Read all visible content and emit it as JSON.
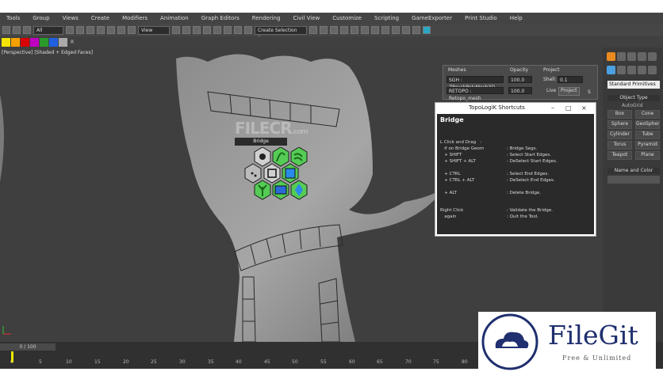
{
  "menu": [
    "Tools",
    "Group",
    "Views",
    "Create",
    "Modifiers",
    "Animation",
    "Graph Editors",
    "Rendering",
    "Civil View",
    "Customize",
    "Scripting",
    "GameExporter",
    "Print Studio",
    "Help"
  ],
  "toolbar": {
    "filter_value": "All",
    "view_value": "View",
    "selection_set_value": "Create Selection Se"
  },
  "colorbar": {
    "swatches": [
      "#f5e400",
      "#f5a000",
      "#d80000",
      "#c000c0",
      "#2a9a2a",
      "#2060e0",
      "#aaaaaa"
    ],
    "letter": "R"
  },
  "viewport": {
    "label": "[Perspective] [Shaded + Edged Faces]"
  },
  "mesh_panel": {
    "meshes_label": "Meshes",
    "opacity_label": "Opacity",
    "project_label": "Project",
    "mesh1": "SGH : ZBrushPolyMesh3D",
    "mesh2": "RETOPO : Retopo_mesh",
    "opacity1": "100.0",
    "opacity2": "100.0",
    "shell_label": "Shell:",
    "shell_value": "0.1",
    "live_label": "Live",
    "project_button": "Project",
    "s_button": "S"
  },
  "dialog": {
    "title": "TopoLogiK Shortcuts",
    "heading": "Bridge",
    "minimize": "–",
    "maximize": "□",
    "close": "×",
    "shortcuts": [
      {
        "key": "L Click and Drag   :",
        "action": ""
      },
      {
        "key": "   if on Bridge Geom",
        "action": ": Bridge Segs."
      },
      {
        "key": "   + SHIFT",
        "action": ": Select Start Edges."
      },
      {
        "key": "   + SHIFT + ALT",
        "action": ": DeSelect Start Edges."
      },
      {
        "key": "   + CTRL",
        "action": ": Select End Edges."
      },
      {
        "key": "   + CTRL + ALT",
        "action": ": DeSelect End Edges."
      },
      {
        "key": "   + ALT",
        "action": ": Delete Bridge."
      },
      {
        "key": "Right Click",
        "action": ": Validate the Bridge."
      },
      {
        "key": "   again",
        "action": ": Quit the Tool."
      }
    ]
  },
  "bridge_tooltip": "Bridge",
  "watermark_cr": "FILECR",
  "watermark_cr_sub": ".com",
  "right_panel": {
    "dropdown": "Standard Primitives",
    "object_type": "Object Type",
    "autogrid": "AutoGrid",
    "buttons": [
      "Box",
      "Cone",
      "Sphere",
      "GeoSphere",
      "Cylinder",
      "Tube",
      "Torus",
      "Pyramid",
      "Teapot",
      "Plane"
    ],
    "name_color": "Name and Color"
  },
  "timeline": {
    "frames": "0 / 100",
    "ticks": [
      "0",
      "5",
      "10",
      "15",
      "20",
      "25",
      "30",
      "35",
      "40",
      "45",
      "50",
      "55",
      "60",
      "65",
      "70",
      "75",
      "80"
    ]
  },
  "filegit": {
    "name": "FileGit",
    "tagline": "Free & Unlimited"
  }
}
